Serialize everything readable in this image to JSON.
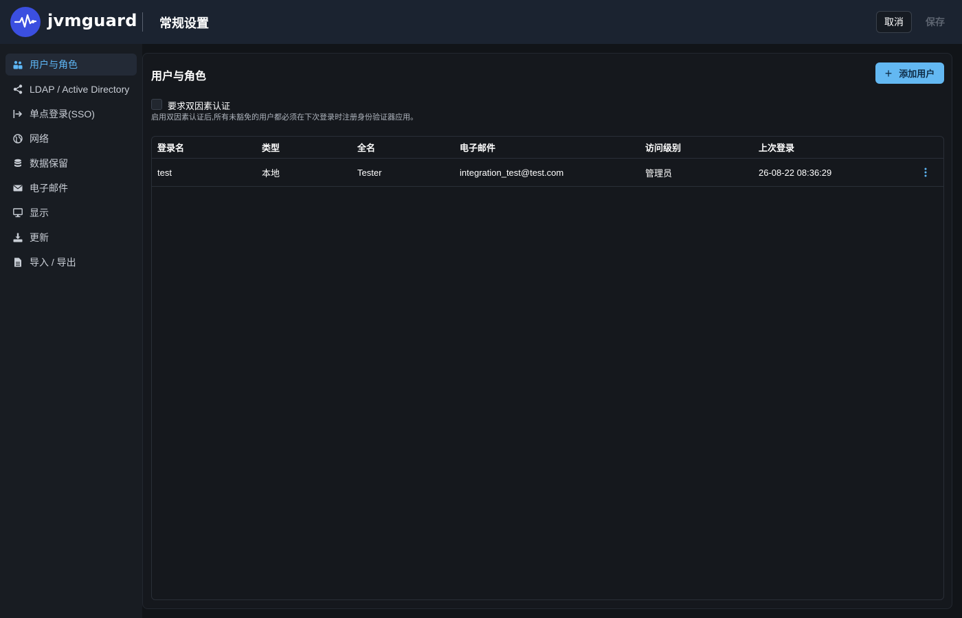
{
  "header": {
    "brand": "jvmguard",
    "title": "常规设置",
    "cancel_label": "取消",
    "save_label": "保存"
  },
  "sidebar": {
    "items": [
      {
        "label": "用户与角色",
        "icon": "users-icon",
        "active": true
      },
      {
        "label": "LDAP / Active Directory",
        "icon": "share-icon",
        "active": false
      },
      {
        "label": "单点登录(SSO)",
        "icon": "sign-in-icon",
        "active": false
      },
      {
        "label": "网络",
        "icon": "globe-icon",
        "active": false
      },
      {
        "label": "数据保留",
        "icon": "database-icon",
        "active": false
      },
      {
        "label": "电子邮件",
        "icon": "envelope-icon",
        "active": false
      },
      {
        "label": "显示",
        "icon": "monitor-icon",
        "active": false
      },
      {
        "label": "更新",
        "icon": "download-icon",
        "active": false
      },
      {
        "label": "导入 / 导出",
        "icon": "file-icon",
        "active": false
      }
    ]
  },
  "main": {
    "section_title": "用户与角色",
    "add_user_label": "添加用户",
    "two_factor": {
      "label": "要求双因素认证",
      "help": "启用双因素认证后,所有未豁免的用户都必须在下次登录时注册身份验证器应用。",
      "checked": false
    },
    "table": {
      "columns": [
        "登录名",
        "类型",
        "全名",
        "电子邮件",
        "访问级别",
        "上次登录"
      ],
      "rows": [
        [
          "test",
          "本地",
          "Tester",
          "integration_test@test.com",
          "管理员",
          "26-08-22 08:36:29"
        ]
      ]
    }
  },
  "colors": {
    "accent": "#5db6f5",
    "primary_button": "#63b8f2",
    "header_bg": "#1b2330",
    "logo_bg": "#3b4fe0"
  }
}
